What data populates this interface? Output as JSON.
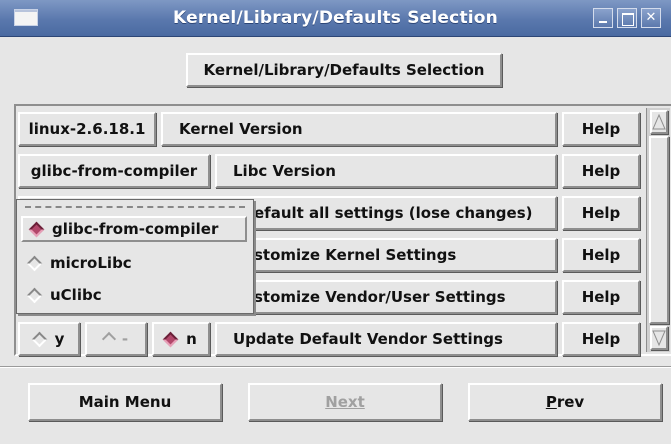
{
  "window": {
    "title": "Kernel/Library/Defaults Selection"
  },
  "header_button": {
    "label": "Kernel/Library/Defaults Selection"
  },
  "rows": {
    "kernel": {
      "value": "linux-2.6.18.1",
      "label": "Kernel Version",
      "help": "Help"
    },
    "libc": {
      "value": "glibc-from-compiler",
      "label": "Libc Version",
      "help": "Help"
    },
    "defaults": {
      "label_visible": "efault all settings (lose changes)",
      "help": "Help"
    },
    "kernel_settings": {
      "label_visible": "stomize Kernel Settings",
      "help": "Help"
    },
    "vendor_settings": {
      "label_visible": "stomize Vendor/User Settings",
      "help": "Help"
    },
    "update_vendor": {
      "options": [
        {
          "label": "y",
          "selected": false
        },
        {
          "label": "-",
          "selected": false
        },
        {
          "label": "n",
          "selected": true
        }
      ],
      "label": "Update Default Vendor Settings",
      "help": "Help"
    }
  },
  "libc_menu": {
    "items": [
      {
        "label": "glibc-from-compiler",
        "selected": true
      },
      {
        "label": "microLibc",
        "selected": false
      },
      {
        "label": "uClibc",
        "selected": false
      }
    ]
  },
  "footer": {
    "main_menu": "Main Menu",
    "next": "Next",
    "prev_first": "P",
    "prev_rest": "rev"
  },
  "colors": {
    "titlebar": "#5a78ad",
    "radio_selected": "#b2476a",
    "background": "#e6e6e6"
  }
}
